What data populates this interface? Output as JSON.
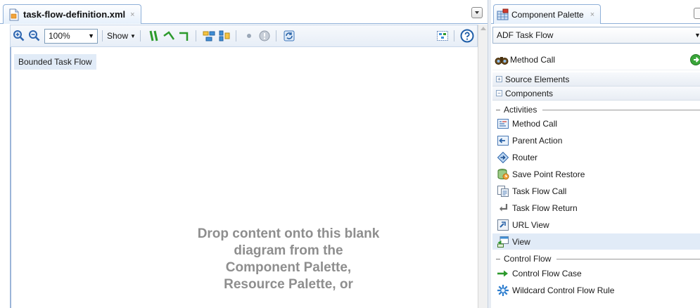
{
  "editor": {
    "tab": {
      "title": "task-flow-definition.xml",
      "close": "×"
    },
    "toolbar": {
      "zoom_value": "100%",
      "show_label": "Show"
    },
    "diagram_label": "Bounded Task Flow",
    "drop_hint": [
      "Drop content onto this blank",
      "diagram from the",
      "Component Palette,",
      "Resource Palette, or"
    ]
  },
  "palette": {
    "tab": {
      "title": "Component Palette",
      "close": "×"
    },
    "library": "ADF Task Flow",
    "search_value": "Method Call",
    "sections": [
      {
        "label": "Source Elements",
        "state": "+"
      },
      {
        "label": "Components",
        "state": "−"
      }
    ],
    "groups": {
      "activities": "Activities",
      "control_flow": "Control Flow"
    },
    "activities": [
      {
        "label": "Method Call",
        "icon": "method-call-icon"
      },
      {
        "label": "Parent Action",
        "icon": "parent-action-icon"
      },
      {
        "label": "Router",
        "icon": "router-icon"
      },
      {
        "label": "Save Point Restore",
        "icon": "save-point-restore-icon"
      },
      {
        "label": "Task Flow Call",
        "icon": "task-flow-call-icon"
      },
      {
        "label": "Task Flow Return",
        "icon": "task-flow-return-icon"
      },
      {
        "label": "URL View",
        "icon": "url-view-icon"
      },
      {
        "label": "View",
        "icon": "view-icon",
        "selected": true
      }
    ],
    "control_flow": [
      {
        "label": "Control Flow Case",
        "icon": "control-flow-case-icon"
      },
      {
        "label": "Wildcard Control Flow Rule",
        "icon": "wildcard-control-flow-rule-icon"
      }
    ]
  },
  "colors": {
    "accent_blue": "#8fb0d8",
    "selection": "#e1ebf7",
    "hint_text": "#8e8e8e",
    "go_green": "#3aa63a"
  }
}
